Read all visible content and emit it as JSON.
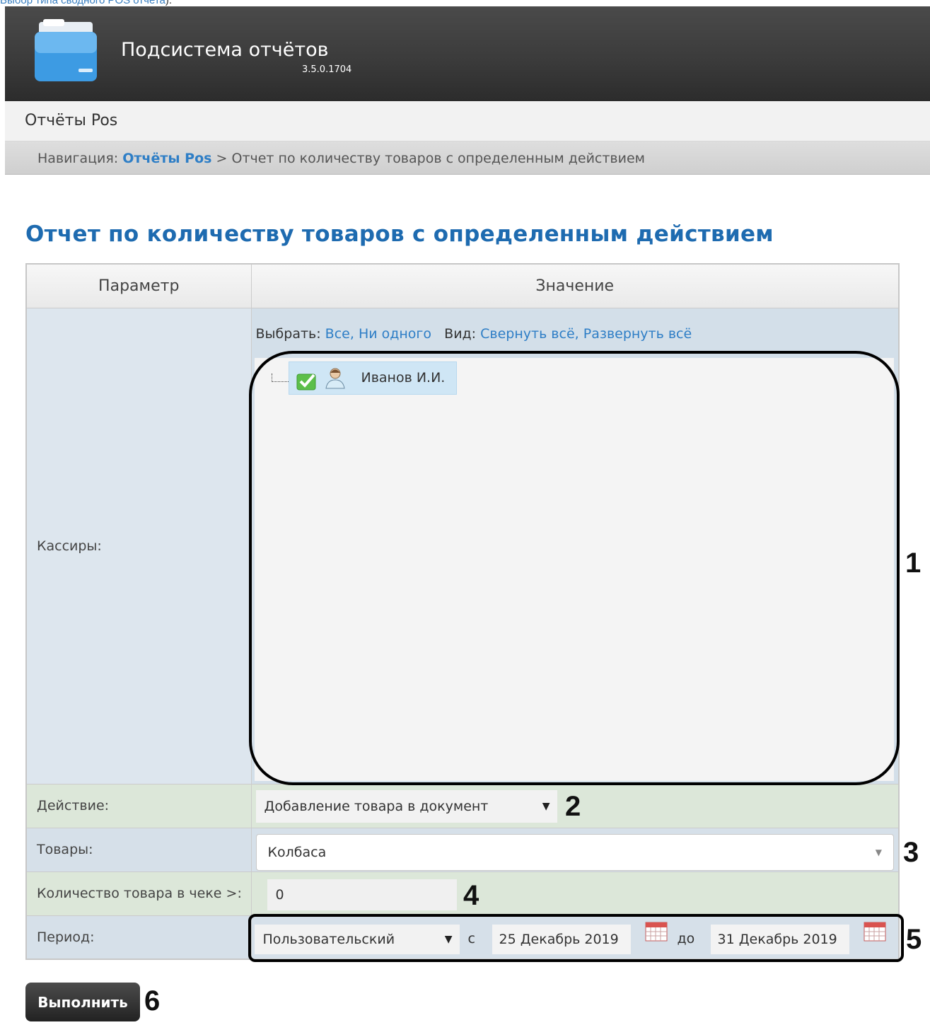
{
  "top_link": {
    "text": "Выбор типа сводного POS отчета",
    "tail": ")."
  },
  "header": {
    "app_title": "Подсистема отчётов",
    "version": "3.5.0.1704"
  },
  "section": {
    "title": "Отчёты Pos"
  },
  "breadcrumb": {
    "prefix": "Навигация:",
    "link": "Отчёты Pos",
    "separator": ">",
    "current": "Отчет по количеству товаров с определенным действием"
  },
  "page_title": "Отчет по количеству товаров с определенным действием",
  "table": {
    "col_param": "Параметр",
    "col_value": "Значение"
  },
  "cashiers": {
    "label": "Кассиры:",
    "select_label": "Выбрать:",
    "select_all": "Все,",
    "select_none": "Ни одного",
    "view_label": "Вид:",
    "collapse_all": "Свернуть всё,",
    "expand_all": "Развернуть всё",
    "tree": [
      {
        "name": "Иванов И.И.",
        "checked": true,
        "icon": "user-icon"
      }
    ]
  },
  "action": {
    "label": "Действие:",
    "value": "Добавление товара в документ"
  },
  "goods": {
    "label": "Товары:",
    "value": "Колбаса"
  },
  "quantity": {
    "label": "Количество товара в чеке >:",
    "value": "0"
  },
  "period": {
    "label": "Период:",
    "value": "Пользовательский",
    "from_label": "с",
    "from": "25 Декабрь 2019",
    "to_label": "до",
    "to": "31 Декабрь 2019"
  },
  "run_button": "Выполнить",
  "markers": [
    "1",
    "2",
    "3",
    "4",
    "5",
    "6"
  ],
  "colors": {
    "header_bg": "#3a3a3a",
    "accent": "#1e6bb0",
    "link": "#2e7ec6"
  }
}
